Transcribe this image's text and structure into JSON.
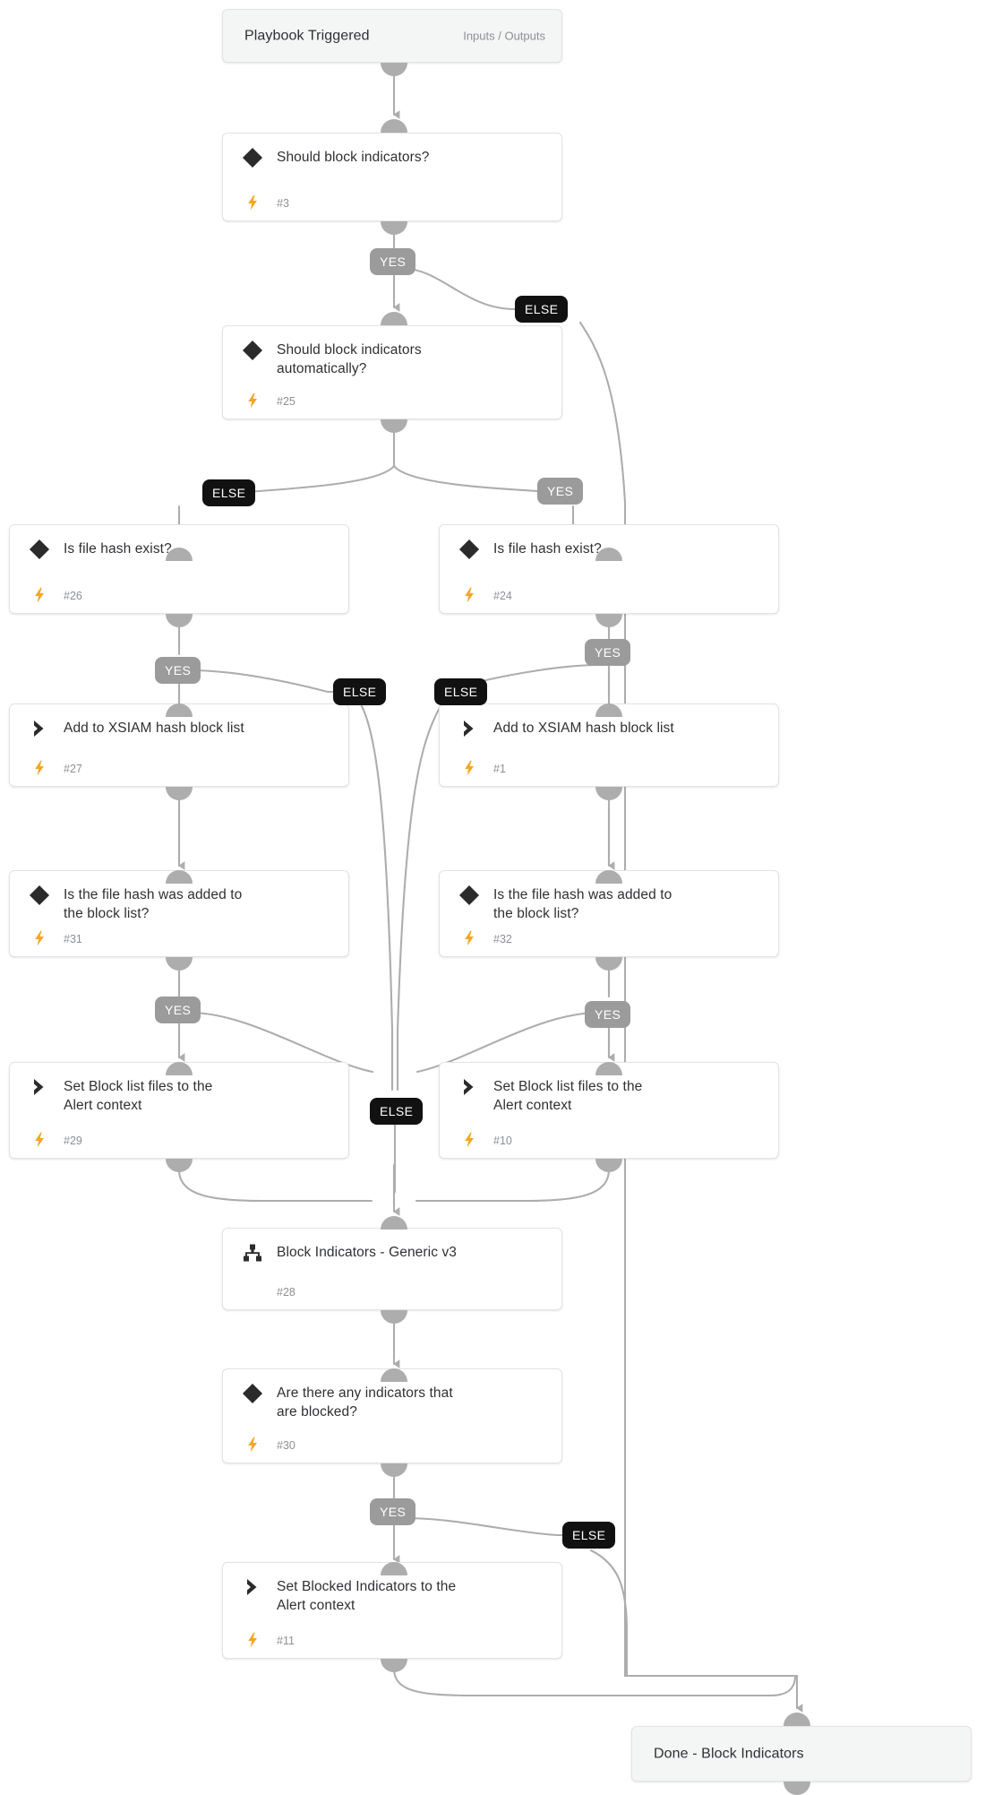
{
  "diagram": {
    "title": "Block Indicators playbook flow",
    "colors": {
      "connector": "#adadad",
      "card_border": "#e3e3e3",
      "card_bg": "#ffffff",
      "terminal_bg": "#f4f5f5",
      "yes_badge": "#9b9b9b",
      "else_badge": "#111111",
      "bolt": "#f5a623",
      "text": "#2f3033",
      "muted_text": "#8d8f93"
    },
    "header": {
      "label": "Playbook Triggered",
      "io_label": "Inputs / Outputs"
    },
    "footer": {
      "label": "Done - Block Indicators"
    },
    "nodes": [
      {
        "id": "n3",
        "label": "Should block indicators?",
        "task": "#3",
        "icon": "condition-diamond-icon",
        "bolt": true
      },
      {
        "id": "n25",
        "label": "Should block indicators\nautomatically?",
        "task": "#25",
        "icon": "condition-diamond-icon",
        "bolt": true
      },
      {
        "id": "n26",
        "label": "Is file hash exist?",
        "task": "#26",
        "icon": "condition-diamond-icon",
        "bolt": true
      },
      {
        "id": "n24",
        "label": "Is file hash exist?",
        "task": "#24",
        "icon": "condition-diamond-icon",
        "bolt": true
      },
      {
        "id": "n27",
        "label": "Add to XSIAM hash block list",
        "task": "#27",
        "icon": "task-chevron-icon",
        "bolt": true
      },
      {
        "id": "n1",
        "label": "Add to XSIAM hash block list",
        "task": "#1",
        "icon": "task-chevron-icon",
        "bolt": true
      },
      {
        "id": "n31",
        "label": "Is the file hash was added to\nthe block list?",
        "task": "#31",
        "icon": "condition-diamond-icon",
        "bolt": true
      },
      {
        "id": "n32",
        "label": "Is the file hash was added to\nthe block list?",
        "task": "#32",
        "icon": "condition-diamond-icon",
        "bolt": true
      },
      {
        "id": "n29",
        "label": "Set Block list files to the\nAlert context",
        "task": "#29",
        "icon": "task-chevron-icon",
        "bolt": true
      },
      {
        "id": "n10",
        "label": "Set Block list files to the\nAlert context",
        "task": "#10",
        "icon": "task-chevron-icon",
        "bolt": true
      },
      {
        "id": "n28",
        "label": "Block Indicators - Generic v3",
        "task": "#28",
        "icon": "subplaybook-icon",
        "bolt": false
      },
      {
        "id": "n30",
        "label": "Are there any indicators that\nare blocked?",
        "task": "#30",
        "icon": "condition-diamond-icon",
        "bolt": true
      },
      {
        "id": "n11",
        "label": "Set Blocked Indicators to the\nAlert context",
        "task": "#11",
        "icon": "task-chevron-icon",
        "bolt": true
      }
    ],
    "badges": [
      {
        "id": "b1",
        "text": "YES",
        "kind": "yes"
      },
      {
        "id": "b2",
        "text": "ELSE",
        "kind": "else"
      },
      {
        "id": "b3",
        "text": "ELSE",
        "kind": "else"
      },
      {
        "id": "b4",
        "text": "YES",
        "kind": "yes"
      },
      {
        "id": "b5",
        "text": "YES",
        "kind": "yes"
      },
      {
        "id": "b6",
        "text": "YES",
        "kind": "yes"
      },
      {
        "id": "b7",
        "text": "ELSE",
        "kind": "else"
      },
      {
        "id": "b8",
        "text": "ELSE",
        "kind": "else"
      },
      {
        "id": "b9",
        "text": "YES",
        "kind": "yes"
      },
      {
        "id": "b10",
        "text": "YES",
        "kind": "yes"
      },
      {
        "id": "b11",
        "text": "ELSE",
        "kind": "else"
      },
      {
        "id": "b12",
        "text": "YES",
        "kind": "yes"
      },
      {
        "id": "b13",
        "text": "ELSE",
        "kind": "else"
      }
    ]
  }
}
